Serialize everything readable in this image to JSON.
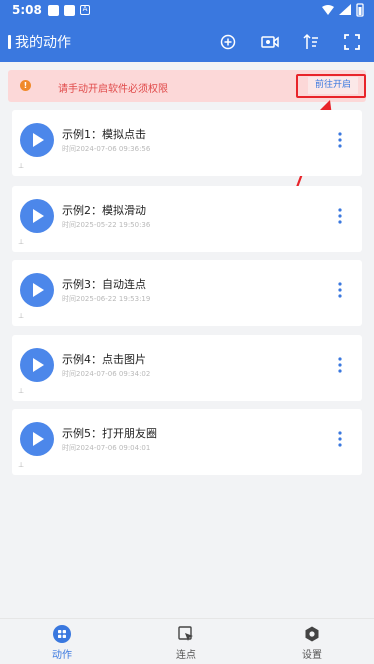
{
  "status": {
    "time": "5:08"
  },
  "appbar": {
    "title": "我的动作"
  },
  "notice": {
    "message": "请手动开启软件必须权限",
    "action": "前往开启"
  },
  "actions": [
    {
      "name": "示例1：模拟点击",
      "meta": "时间2024-07-06 09:36:56"
    },
    {
      "name": "示例2：模拟滑动",
      "meta": "时间2025-05-22 19:50:36"
    },
    {
      "name": "示例3：自动连点",
      "meta": "时间2025-06-22 19:53:19"
    },
    {
      "name": "示例4：点击图片",
      "meta": "时间2024-07-06 09:34:02"
    },
    {
      "name": "示例5：打开朋友圈",
      "meta": "时间2024-07-06 09:04:01"
    }
  ],
  "nav": {
    "tabs": [
      "动作",
      "连点",
      "设置"
    ]
  },
  "colors": {
    "primary": "#3a78df",
    "notice_bg": "#fcd8d8",
    "highlight": "#e8242a"
  }
}
